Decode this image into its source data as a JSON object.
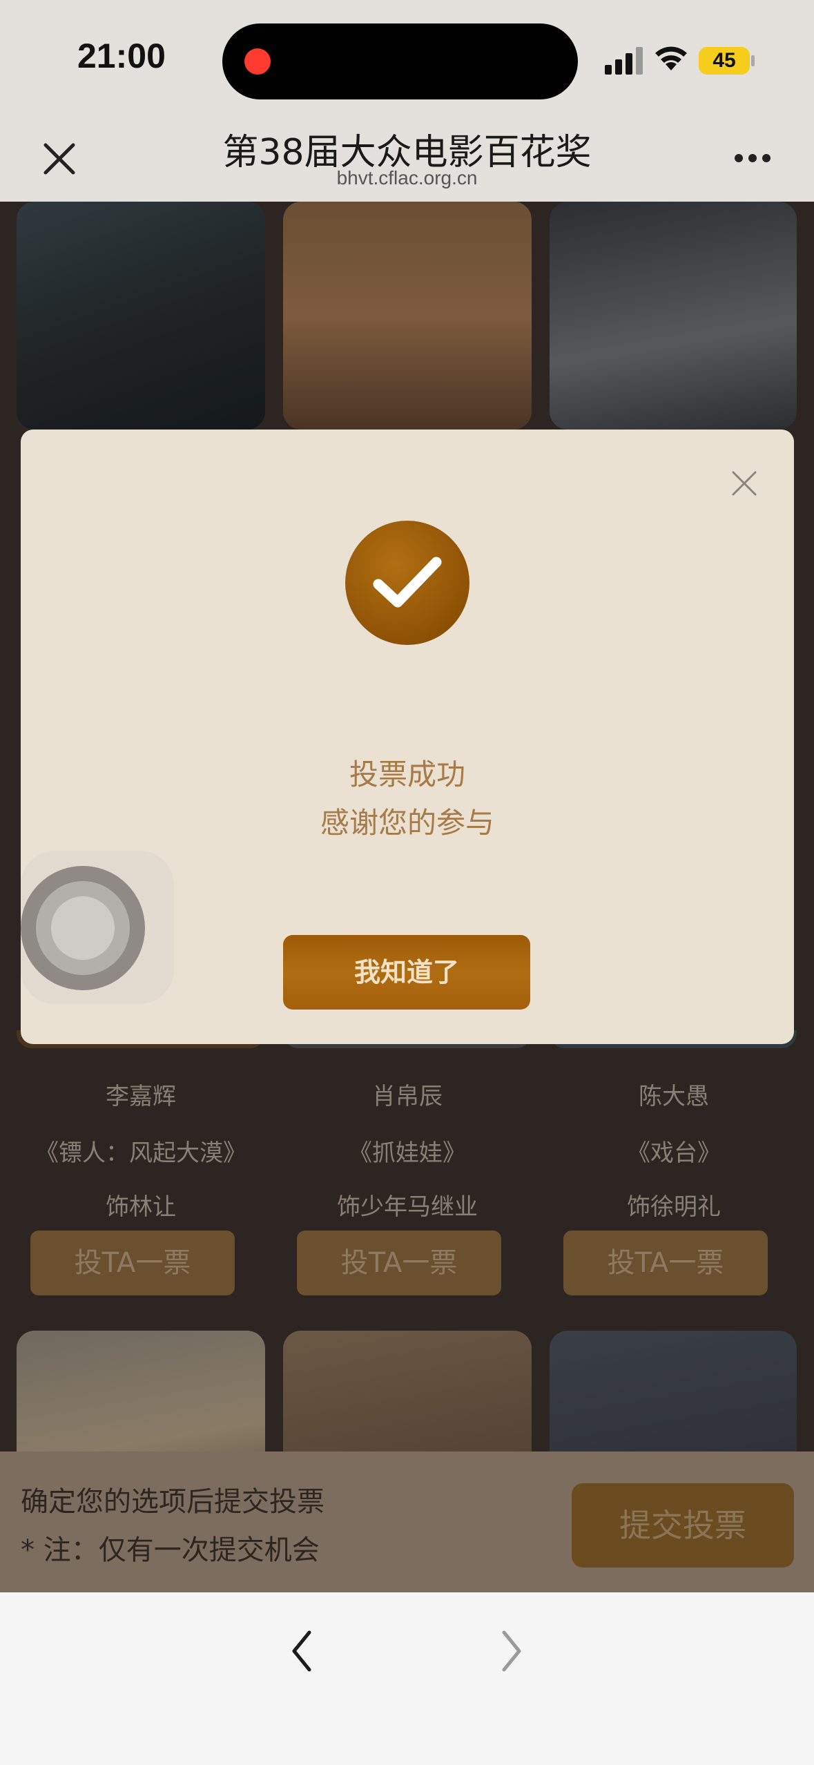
{
  "status_bar": {
    "time": "21:00",
    "battery": "45"
  },
  "header": {
    "title": "第38届大众电影百花奖",
    "url": "bhvt.cflac.org.cn"
  },
  "candidates": [
    {
      "name": "李嘉辉",
      "film": "《镖人：风起大漠》",
      "role": "饰林让",
      "vote_label": "投TA一票"
    },
    {
      "name": "肖帛辰",
      "film": "《抓娃娃》",
      "role": "饰少年马继业",
      "vote_label": "投TA一票"
    },
    {
      "name": "陈大愚",
      "film": "《戏台》",
      "role": "饰徐明礼",
      "vote_label": "投TA一票"
    }
  ],
  "submit_bar": {
    "line1": "确定您的选项后提交投票",
    "line2": "* 注：仅有一次提交机会",
    "button": "提交投票"
  },
  "modal": {
    "line1": "投票成功",
    "line2": "感谢您的参与",
    "button": "我知道了"
  },
  "colors": {
    "accent": "#a05c0a",
    "modal_bg": "#ebe1d3",
    "text_gold": "#a77b48"
  }
}
